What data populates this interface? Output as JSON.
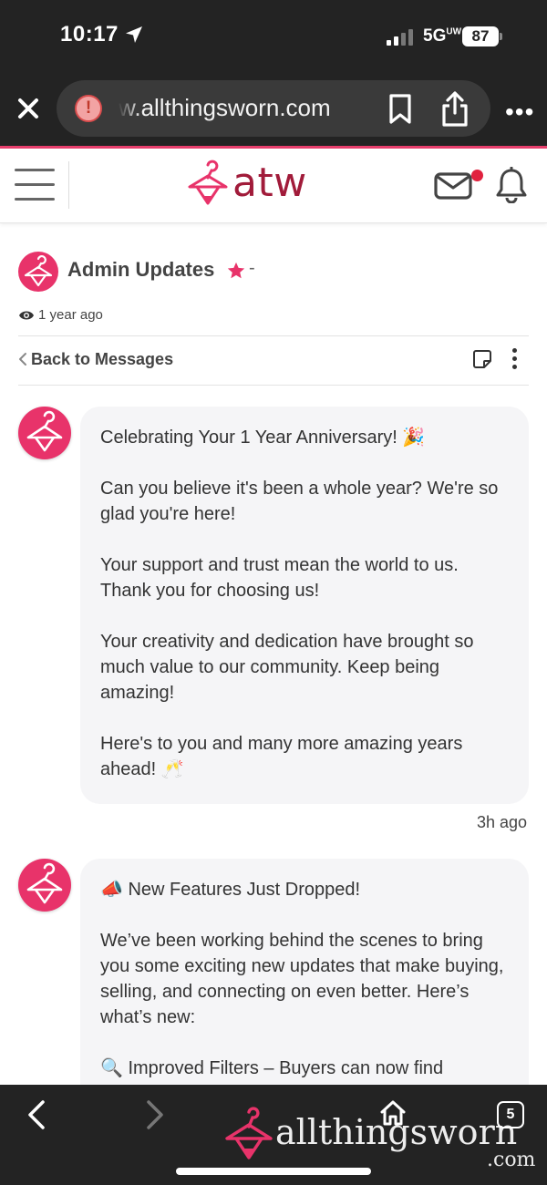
{
  "status_bar": {
    "time": "10:17",
    "network": "5G",
    "network_suffix": "UW",
    "battery": "87"
  },
  "browser": {
    "url": "w.allthingsworn.com",
    "tabs_count": "5",
    "watermark_main": "allthingsworn",
    "watermark_suffix": ".com"
  },
  "site": {
    "logo_text": "atw",
    "brand_color": "#e8336a",
    "logo_color": "#a11b3a"
  },
  "conversation": {
    "title": "Admin Updates",
    "title_suffix": "-",
    "last_seen": "1 year ago",
    "back_label": "Back to Messages"
  },
  "messages": [
    {
      "paragraphs": [
        "Celebrating Your 1 Year Anniversary! 🎉",
        "Can you believe it's been a whole year? We're so glad you're here!",
        "Your support and trust mean the world to us. Thank you for choosing us!",
        "Your creativity and dedication have brought so much value to our community. Keep being amazing!",
        "Here's to you and many more amazing years ahead! 🥂"
      ],
      "time": "3h ago"
    },
    {
      "paragraphs": [
        "📣 New Features Just Dropped!",
        "We’ve been working behind the scenes to bring you some exciting new updates that make buying, selling, and connecting on even better. Here’s what’s new:",
        "🔍 Improved Filters – Buyers can now find"
      ]
    }
  ]
}
